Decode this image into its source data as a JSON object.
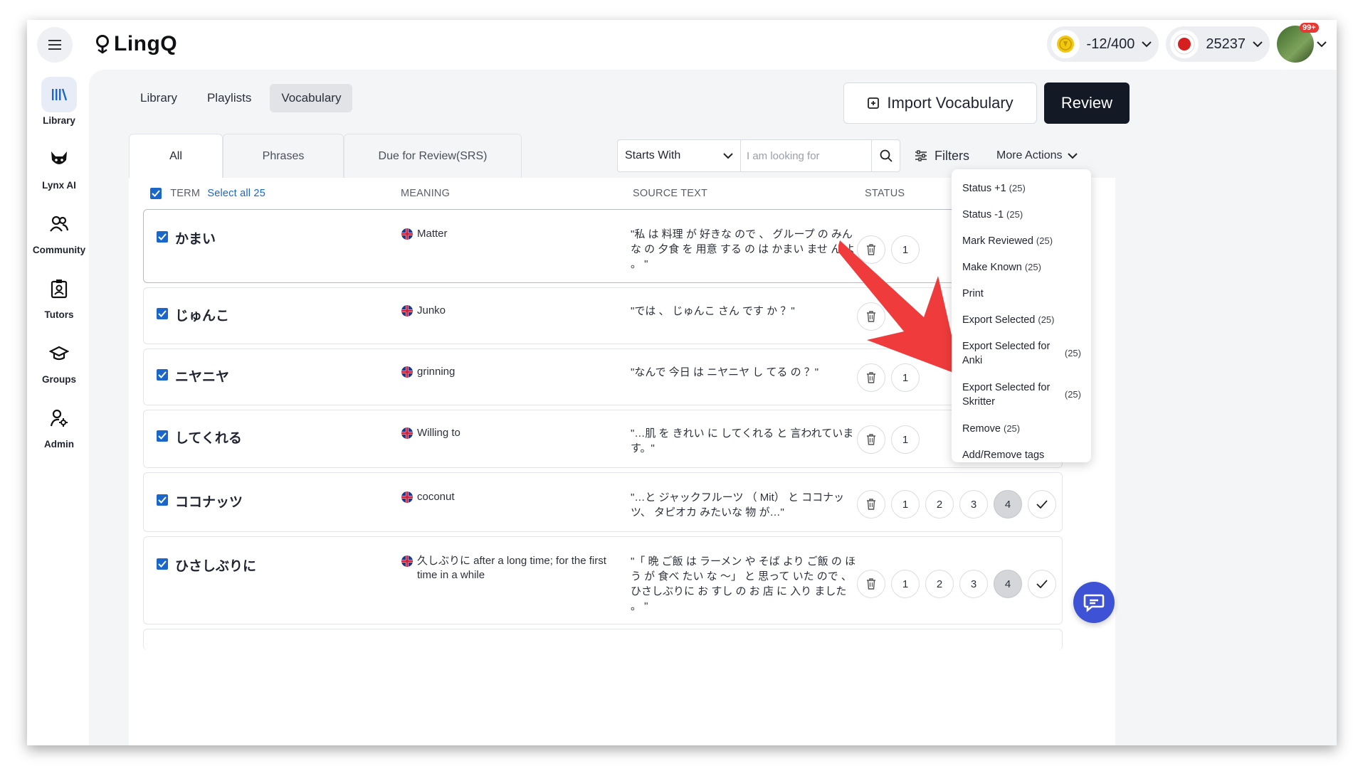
{
  "header": {
    "logo_text": "LingQ",
    "coins_label": "-12/400",
    "streak_label": "25237",
    "notif_badge": "99+"
  },
  "sidebar": {
    "items": [
      {
        "label": "Library",
        "icon": "library-icon",
        "active": true
      },
      {
        "label": "Lynx AI",
        "icon": "lynx-icon"
      },
      {
        "label": "Community",
        "icon": "community-icon"
      },
      {
        "label": "Tutors",
        "icon": "tutors-icon"
      },
      {
        "label": "Groups",
        "icon": "groups-icon"
      },
      {
        "label": "Admin",
        "icon": "admin-icon"
      }
    ]
  },
  "top_tabs": [
    "Library",
    "Playlists",
    "Vocabulary"
  ],
  "active_top_tab": "Vocabulary",
  "buttons": {
    "import": "Import Vocabulary",
    "review": "Review"
  },
  "sub_tabs": [
    "All",
    "Phrases",
    "Due for Review(SRS)"
  ],
  "search": {
    "mode": "Starts With",
    "placeholder": "I am looking for",
    "filters_label": "Filters",
    "more_actions_label": "More Actions"
  },
  "columns": {
    "term": "TERM",
    "select_all": "Select all 25",
    "meaning": "MEANING",
    "source": "SOURCE TEXT",
    "status": "STATUS"
  },
  "rows": [
    {
      "term": "かまい",
      "meaning": "Matter",
      "source": "\"私 は 料理 が 好きな ので 、 グループ の みん な の 夕食 を 用意 する の は かまい ませ ん よ 。 \""
    },
    {
      "term": "じゅんこ",
      "meaning": "Junko",
      "source": "\"では 、 じゅんこ さん です か ？\""
    },
    {
      "term": "ニヤニヤ",
      "meaning": "grinning",
      "source": "\"なんで 今日 は ニヤニヤ し てる の ？\""
    },
    {
      "term": "してくれる",
      "meaning": "Willing to",
      "source": "\"…肌 を きれい に してくれる と 言われていま す。\""
    },
    {
      "term": "ココナッツ",
      "meaning": "coconut",
      "source": "\"…と ジャックフルーツ （ Mit） と ココナッ ツ、 タピオカ みたいな 物 が…\""
    },
    {
      "term": "ひさしぶりに",
      "meaning": "久しぶりに after a long time; for the first time in a while",
      "source": "\"「 晩 ご飯 は ラーメン や そば より ご飯 の ほ う が 食べ たい な ～」 と 思って いた ので 、 ひさしぶりに お すし の お 店 に 入り ました 。 \""
    }
  ],
  "status_buttons": [
    "1",
    "2",
    "3",
    "4"
  ],
  "dropdown": {
    "items": [
      {
        "label": "Status +1",
        "count": "(25)"
      },
      {
        "label": "Status -1",
        "count": "(25)"
      },
      {
        "label": "Mark Reviewed",
        "count": "(25)"
      },
      {
        "label": "Make Known",
        "count": "(25)"
      },
      {
        "label": "Print",
        "count": ""
      },
      {
        "label": "Export Selected",
        "count": "(25)"
      },
      {
        "label": "Export Selected for Anki",
        "count": "(25)"
      },
      {
        "label": "Export Selected for Skritter",
        "count": "(25)"
      },
      {
        "label": "Remove",
        "count": "(25)"
      },
      {
        "label": "Add/Remove tags",
        "count": ""
      }
    ]
  },
  "colors": {
    "accent": "#1b66c9",
    "review_bg": "#131a26",
    "chat_fab": "#3d52d5",
    "arrow": "#ef3b3b"
  }
}
